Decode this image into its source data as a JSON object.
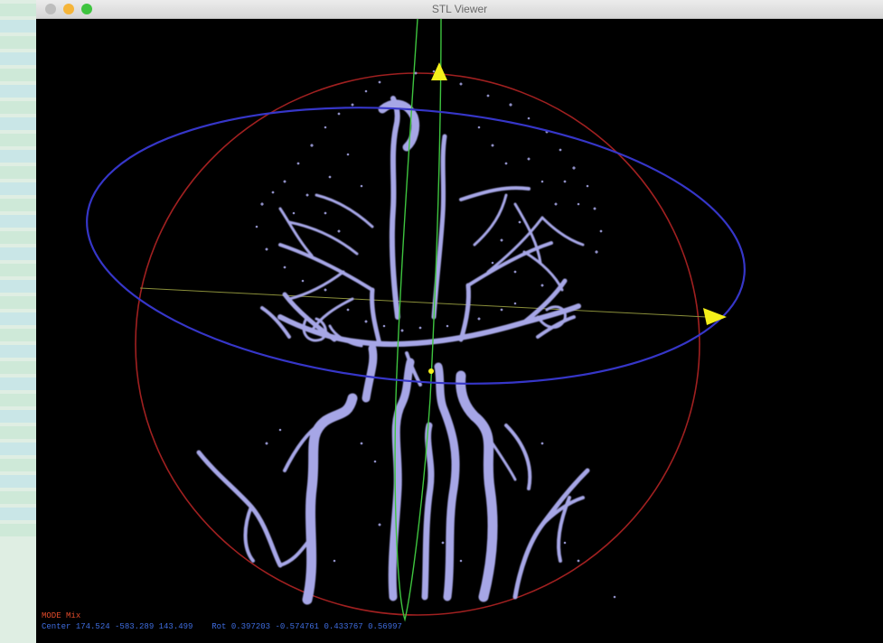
{
  "window": {
    "title": "STL Viewer"
  },
  "overlay": {
    "mode_label": "MODE",
    "mode_value": "Mix",
    "center_label": "Center",
    "center_value": "174.524 -583.289 143.499",
    "rot_label": "Rot",
    "rot_value": "0.397203 -0.574761 0.433767 0.56997"
  },
  "colors": {
    "vessel": "#a6a6e6",
    "ring_horizontal": "#3636c8",
    "ring_vertical_red": "#a02020",
    "ring_vertical_green": "#3ec43f",
    "arrow": "#f4f01a"
  }
}
